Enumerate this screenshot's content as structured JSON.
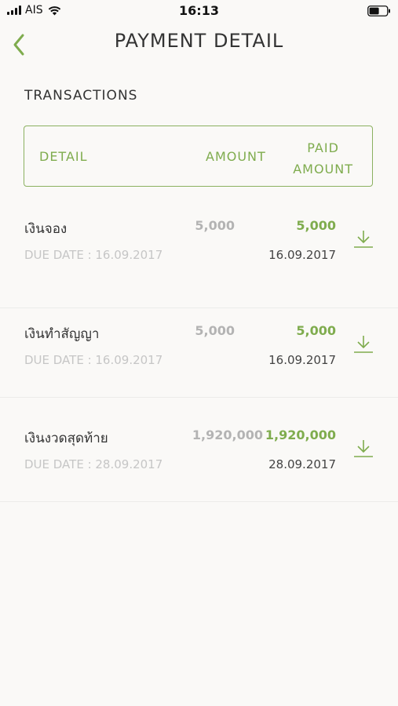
{
  "status_bar": {
    "carrier": "AIS",
    "time": "16:13"
  },
  "nav": {
    "title": "PAYMENT DETAIL"
  },
  "section": {
    "label": "TRANSACTIONS"
  },
  "table_header": {
    "detail": "DETAIL",
    "amount": "AMOUNT",
    "paid_line1": "PAID",
    "paid_line2": "AMOUNT"
  },
  "transactions": [
    {
      "name": "เงินจอง",
      "amount": "5,000",
      "paid_amount": "5,000",
      "due_date": "DUE DATE : 16.09.2017",
      "paid_date": "16.09.2017"
    },
    {
      "name": "เงินทำสัญญา",
      "amount": "5,000",
      "paid_amount": "5,000",
      "due_date": "DUE DATE : 16.09.2017",
      "paid_date": "16.09.2017"
    },
    {
      "name": "เงินงวดสุดท้าย",
      "amount": "1,920,000",
      "paid_amount": "1,920,000",
      "due_date": "DUE DATE : 28.09.2017",
      "paid_date": "28.09.2017"
    }
  ],
  "colors": {
    "accent": "#7fac4e",
    "background": "#faf9f7",
    "muted_amount": "#b3b3b3"
  },
  "icons": {
    "back": "chevron-left-icon",
    "download": "download-icon"
  }
}
